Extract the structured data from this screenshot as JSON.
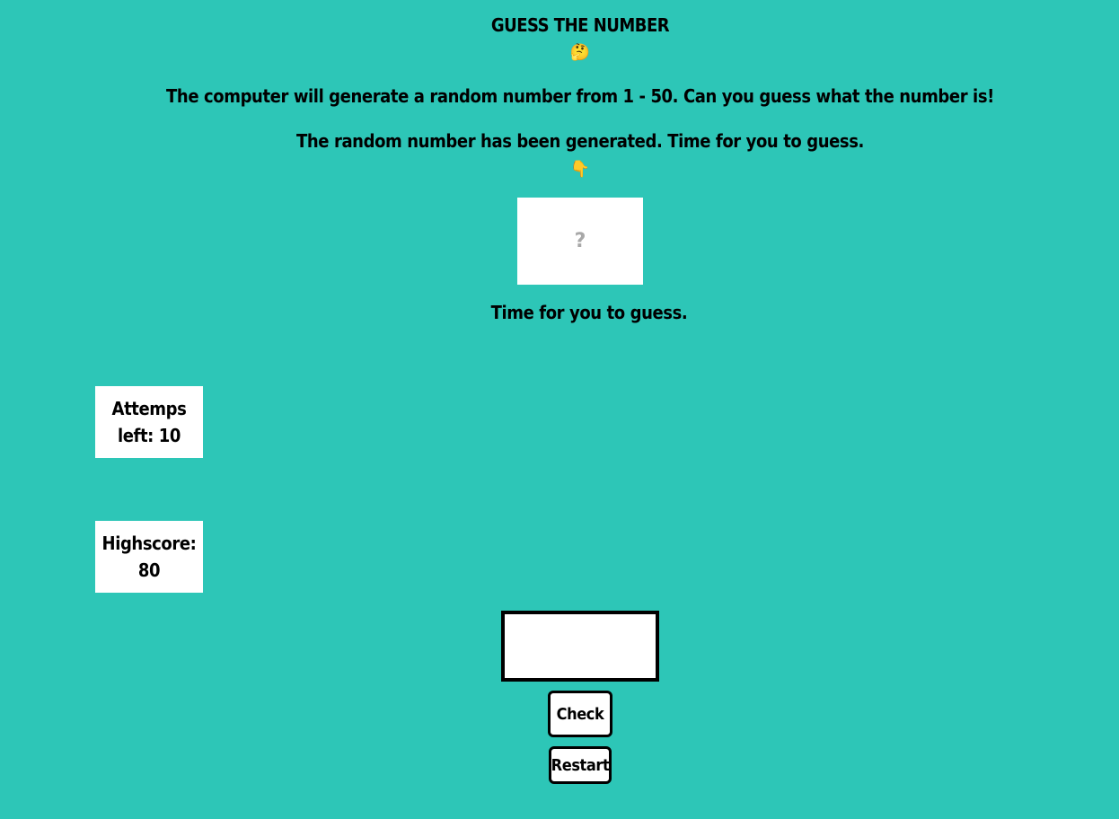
{
  "header": {
    "title": "GUESS THE NUMBER",
    "title_emoji": "🤔",
    "intro": "The computer will generate a random number from 1 - 50. Can you guess what the number is!",
    "generated_text": "The random number has been generated. Time for you to guess.",
    "pointer_emoji": "👇"
  },
  "secret": {
    "display": "?"
  },
  "message": "Time for you to guess.",
  "stats": {
    "attempts_label": "Attemps left: 10",
    "highscore_label": "Highscore: 80"
  },
  "guess_input": {
    "value": "",
    "placeholder": ""
  },
  "buttons": {
    "check": "Check",
    "restart": "Restart"
  },
  "colors": {
    "background": "#2dc6b7",
    "box": "#ffffff",
    "text": "#000000",
    "secret_mark": "#a8a8a8"
  }
}
